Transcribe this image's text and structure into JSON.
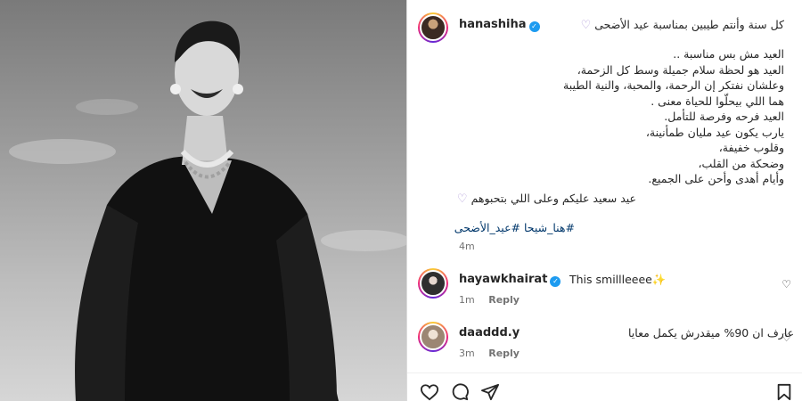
{
  "post": {
    "author": "hanashiha",
    "caption_head": "كل سنة وأنتم طيبين بمناسبة عيد الأضحى",
    "caption_lines": [
      "العيد مش بس مناسبة ..",
      "العيد هو لحظة سلام جميلة وسط كل الزحمة،",
      "وعلشان نفتكر إن الرحمة، والمحبة، والنية الطيبة",
      "هما اللي بيحلّوا للحياة معنى .",
      "العيد فرحه وفرصة للتأمل.",
      "يارب يكون عيد مليان طمأنينة،",
      "وقلوب خفيفة،",
      "وضحكة من القلب،",
      "وأيام أهدى وأحن على الجميع."
    ],
    "closing": "عيد سعيد عليكم وعلى اللي بتحبوهم",
    "hashtags": "#هنا_شيحا #عيد_الأضحى",
    "time": "4m"
  },
  "comments": [
    {
      "user": "hayawkhairat",
      "verified": true,
      "text": "This smillleeee✨",
      "time": "1m",
      "reply_label": "Reply"
    },
    {
      "user": "daaddd.y",
      "verified": false,
      "text": "عارف ان 90% ميقدرش يكمل معايا",
      "time": "3m",
      "reply_label": "Reply"
    }
  ],
  "icons": {
    "verified": "✓",
    "purple_heart": "♡",
    "comment_like": "♡"
  },
  "colors": {
    "link": "#00376b",
    "verified": "#1d9bf0",
    "muted": "#737373"
  }
}
